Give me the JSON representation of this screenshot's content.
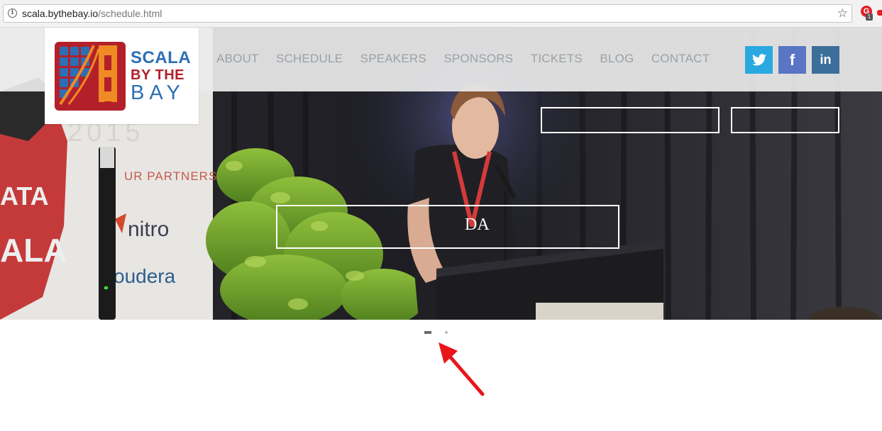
{
  "browser": {
    "url_host": "scala.bythebay.io",
    "url_path": "/schedule.html",
    "info_icon": "info-icon",
    "bookmark_icon": "star-icon",
    "extension_badge": "1"
  },
  "brand": {
    "logo_line1": "SCALA",
    "logo_line2": "BY THE",
    "logo_line3": "BAY",
    "colors": {
      "blue": "#2c6fb5",
      "red": "#b3202a",
      "orange": "#f08a24"
    }
  },
  "nav": {
    "items": [
      {
        "label": "ABOUT"
      },
      {
        "label": "SCHEDULE"
      },
      {
        "label": "SPEAKERS"
      },
      {
        "label": "SPONSORS"
      },
      {
        "label": "TICKETS"
      },
      {
        "label": "BLOG"
      },
      {
        "label": "CONTACT"
      }
    ]
  },
  "social": {
    "twitter": {
      "glyph": "🐦",
      "icon": "twitter-icon",
      "color": "#2aa9e0"
    },
    "facebook": {
      "glyph": "f",
      "icon": "facebook-icon",
      "color": "#5a75c4"
    },
    "linkedin": {
      "glyph": "in",
      "icon": "linkedin-icon",
      "color": "#3c6e9a"
    }
  },
  "hero": {
    "banner_texts": [
      "2015",
      "UR PARTNERS",
      "nitro",
      "oudera",
      "ATA",
      "ALA"
    ],
    "shirt_text": "DA"
  },
  "carousel": {
    "slide_count": 2,
    "active_index": 0
  },
  "annotation": {
    "arrow_color": "#e8161b"
  }
}
